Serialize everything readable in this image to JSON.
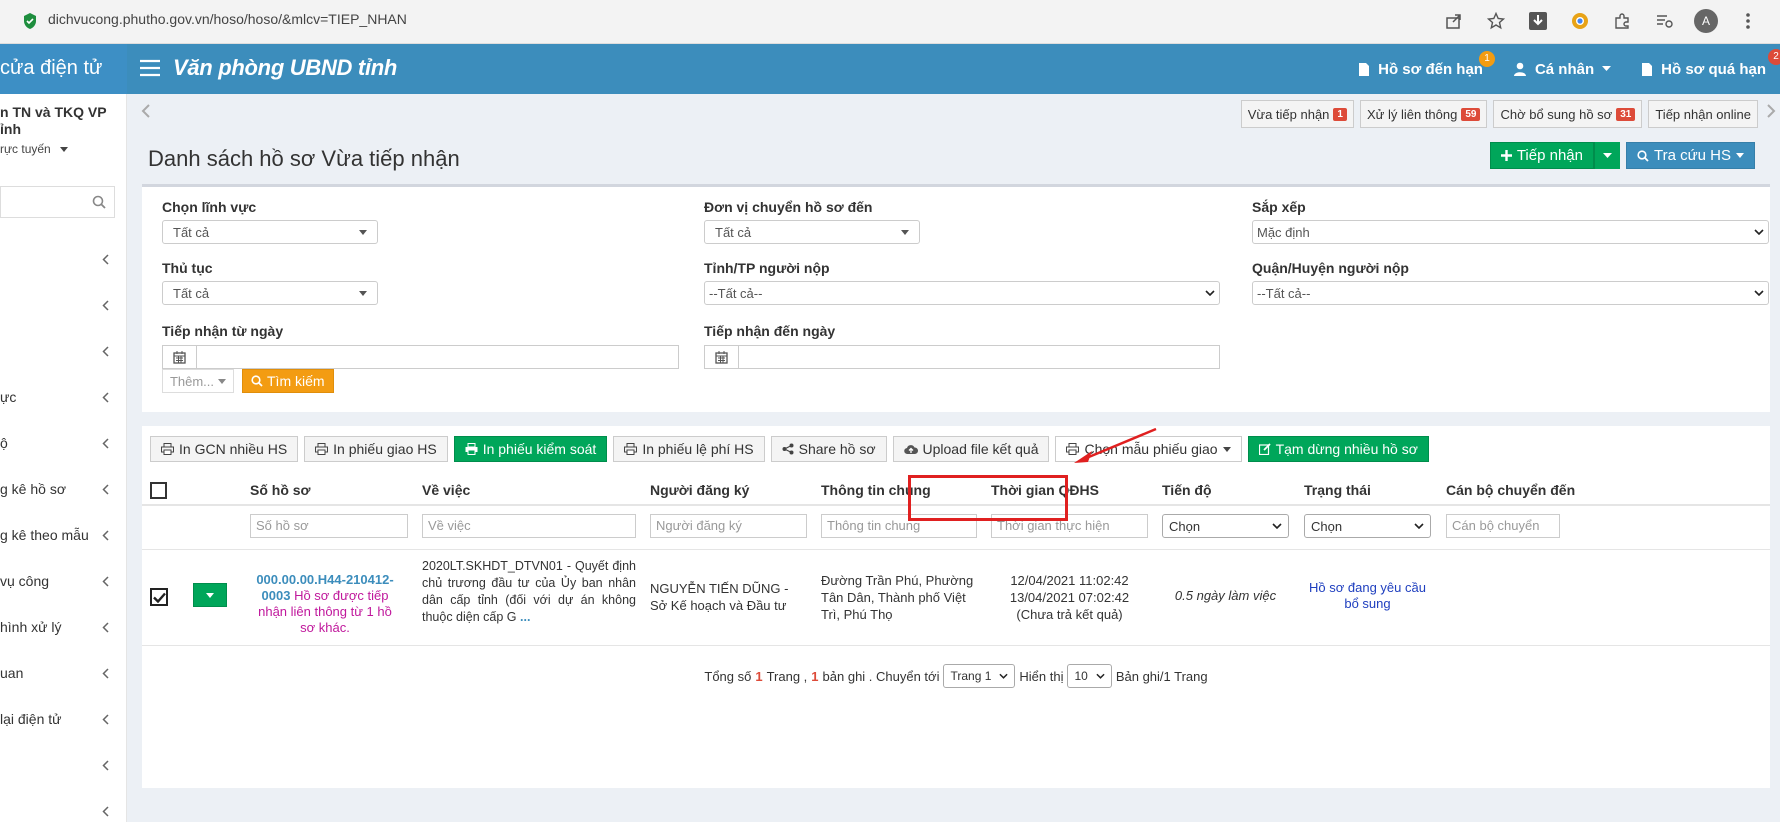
{
  "browser": {
    "url": "dichvucong.phutho.gov.vn/hoso/hoso/&mlcv=TIEP_NHAN",
    "avatar": "A"
  },
  "sidebar": {
    "header": "cửa điện tử",
    "user_line1": "n TN và TKQ VP",
    "user_line2": "ỉnh",
    "status": "rực tuyến",
    "items": [
      {
        "label": ""
      },
      {
        "label": ""
      },
      {
        "label": ""
      },
      {
        "label": "ực"
      },
      {
        "label": "ộ"
      },
      {
        "label": "g kê hồ sơ"
      },
      {
        "label": "g kê theo mẫu"
      },
      {
        "label": "vụ công"
      },
      {
        "label": "hình xử lý"
      },
      {
        "label": "uan"
      },
      {
        "label": "lại điện tử"
      },
      {
        "label": ""
      },
      {
        "label": ""
      }
    ]
  },
  "header": {
    "title": "Văn phòng UBND tỉnh",
    "nav": {
      "due": {
        "label": "Hồ sơ đến hạn",
        "count": "1"
      },
      "personal": {
        "label": "Cá nhân"
      },
      "overdue": {
        "label": "Hồ sơ quá hạn",
        "count": "2"
      }
    }
  },
  "quick_tabs": [
    {
      "label": "Vừa tiếp nhận",
      "count": "1"
    },
    {
      "label": "Xử lý liên thông",
      "count": "59"
    },
    {
      "label": "Chờ bổ sung hồ sơ",
      "count": "31"
    },
    {
      "label": "Tiếp nhận online",
      "count": ""
    }
  ],
  "page": {
    "title": "Danh sách hồ sơ Vừa tiếp nhận",
    "btn_receive": "Tiếp nhận",
    "btn_lookup": "Tra cứu HS"
  },
  "filters": {
    "field_label": "Chọn lĩnh vực",
    "field_value": "Tất cả",
    "unit_label": "Đơn vị chuyển hồ sơ đến",
    "unit_value": "Tất cả",
    "sort_label": "Sắp xếp",
    "sort_value": "Mặc định",
    "procedure_label": "Thủ tục",
    "procedure_value": "Tất cả",
    "province_label": "Tỉnh/TP người nộp",
    "province_value": "--Tất cả--",
    "district_label": "Quận/Huyện người nộp",
    "district_value": "--Tất cả--",
    "from_label": "Tiếp nhận từ ngày",
    "to_label": "Tiếp nhận đến ngày",
    "more_label": "Thêm...",
    "search_label": "Tìm kiếm"
  },
  "toolbar": {
    "print_gcn": "In GCN nhiều HS",
    "print_delivery": "In phiếu giao HS",
    "print_control": "In phiếu kiểm soát",
    "print_fee": "In phiếu lệ phí HS",
    "share": "Share hồ sơ",
    "upload": "Upload file kết quả",
    "choose_template": "Chọn mẫu phiếu giao",
    "suspend": "Tạm dừng nhiều hồ sơ"
  },
  "table": {
    "headers": {
      "id": "Số hồ sơ",
      "subject": "Về việc",
      "applicant": "Người đăng ký",
      "info": "Thông tin chung",
      "time": "Thời gian QĐHS",
      "progress": "Tiến độ",
      "status": "Trạng thái",
      "officer": "Cán bộ chuyển đến"
    },
    "placeholders": {
      "id": "Số hồ sơ",
      "subject": "Về việc",
      "applicant": "Người đăng ký",
      "info": "Thông tin chung",
      "time": "Thời gian thực hiện",
      "progress": "Chọn",
      "status": "Chọn",
      "officer": "Cán bộ chuyển"
    },
    "row": {
      "id_line1": "000.00.00.H44-210412-",
      "id_line2": "0003",
      "id_note": "Hồ sơ được tiếp nhận liên thông từ 1 hồ sơ khác.",
      "subject": "2020LT.SKHDT_DTVN01 - Quyết định chủ trương đầu tư của Ủy ban nhân dân cấp tỉnh (đối với dự án không thuộc diện cấp G",
      "subject_more": "...",
      "applicant": "NGUYỄN TIẾN DŨNG - Sở Kế hoạch và Đầu tư",
      "info": "Đường Trần Phú, Phường Tân Dân, Thành phố Việt Trì, Phú Thọ",
      "time_start": "12/04/2021 11:02:42",
      "time_end": "13/04/2021 07:02:42",
      "time_note": "(Chưa trả kết quả)",
      "progress": "0.5 ngày làm việc",
      "status": "Hồ sơ đang yêu cầu bổ sung"
    }
  },
  "pager": {
    "total_prefix": "Tổng số",
    "pages": "1",
    "page_word": "Trang ,",
    "records": "1",
    "records_word": "bản ghi . Chuyển tới",
    "page_select": "Trang 1",
    "show_label": "Hiển thị",
    "page_size": "10",
    "suffix": "Bản ghi/1 Trang"
  }
}
